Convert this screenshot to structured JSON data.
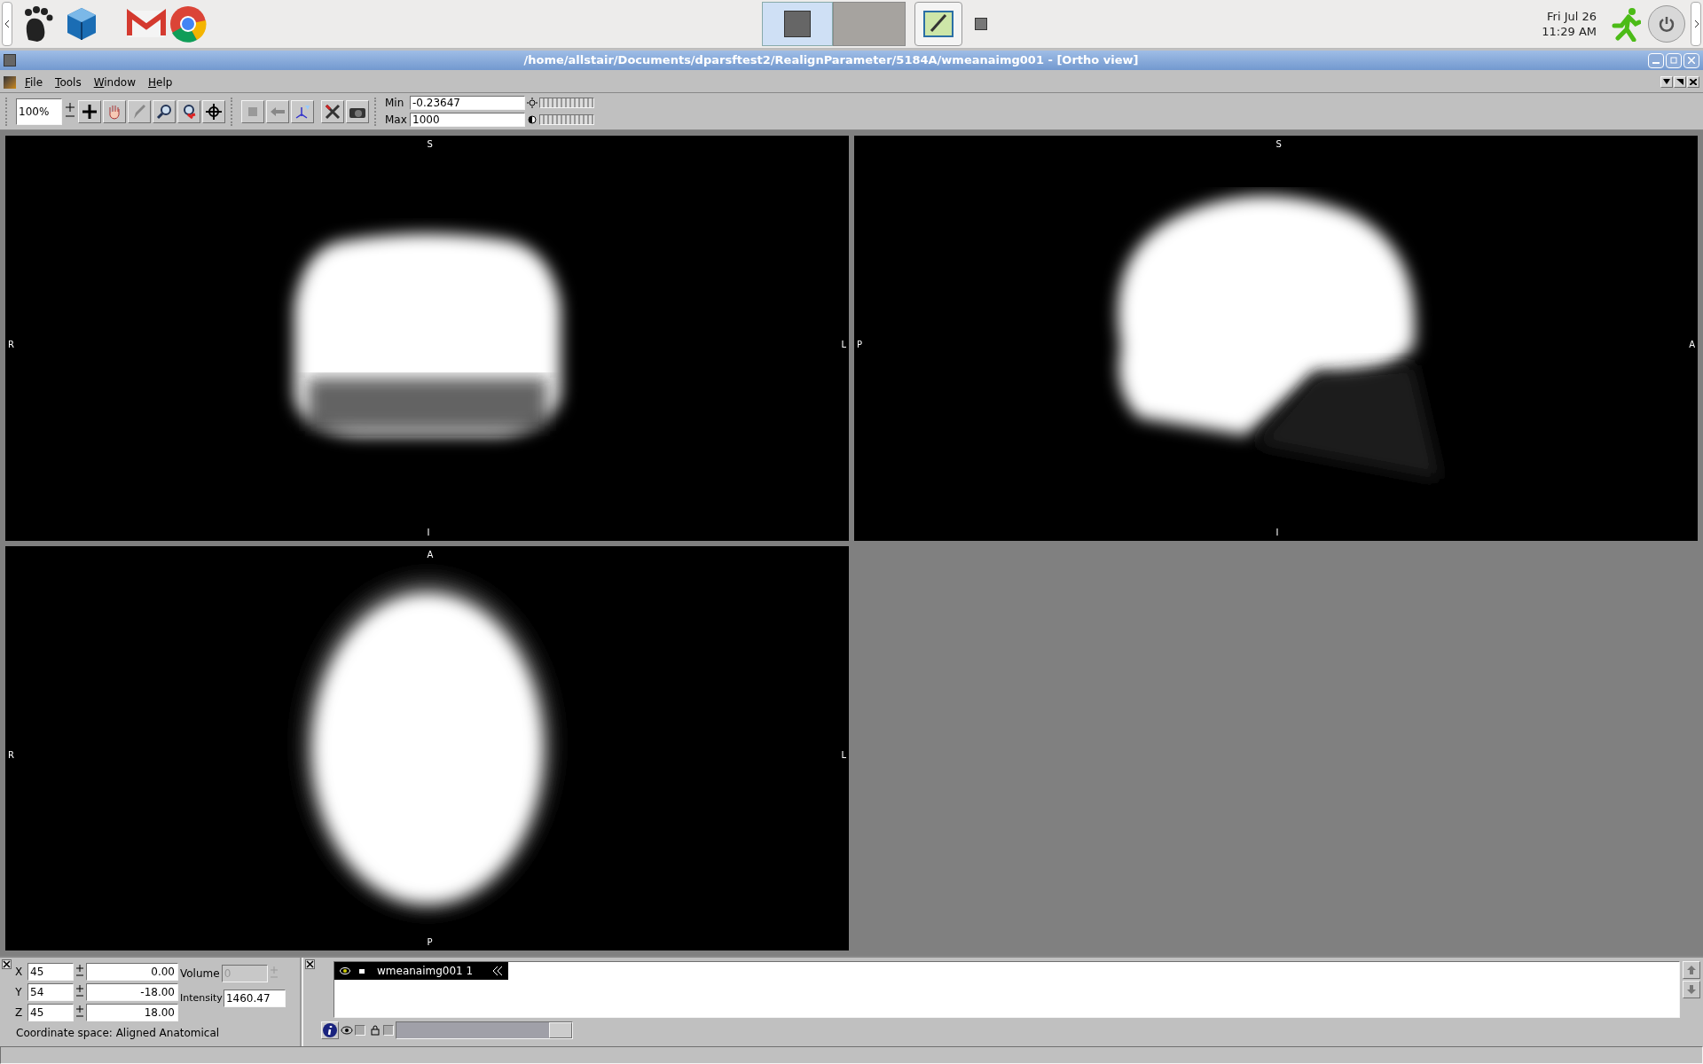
{
  "taskbar": {
    "date": "Fri Jul 26",
    "time": "11:29 AM"
  },
  "window": {
    "title": "/home/allstair/Documents/dparsftest2/RealignParameter/5184A/wmeanaimg001 - [Ortho view]"
  },
  "menu": [
    {
      "label": "File"
    },
    {
      "label": "Tools"
    },
    {
      "label": "Window"
    },
    {
      "label": "Help"
    }
  ],
  "toolbar": {
    "zoom": "100%",
    "min_label": "Min",
    "min": "-0.23647",
    "max_label": "Max",
    "max": "1000"
  },
  "views": [
    {
      "kind": "coronal",
      "top": "S",
      "bottom": "I",
      "left": "R",
      "right": "L"
    },
    {
      "kind": "sagittal",
      "top": "S",
      "bottom": "I",
      "left": "P",
      "right": "A"
    },
    {
      "kind": "axial",
      "top": "A",
      "bottom": "P",
      "left": "R",
      "right": "L"
    }
  ],
  "location": {
    "rows": [
      {
        "axis": "X",
        "voxel": "45",
        "world": "0.00"
      },
      {
        "axis": "Y",
        "voxel": "54",
        "world": "-18.00"
      },
      {
        "axis": "Z",
        "voxel": "45",
        "world": "18.00"
      }
    ],
    "volume_label": "Volume",
    "volume": "0",
    "volume_disabled": true,
    "intensity_label": "Intensity",
    "intensity": "1460.47",
    "coordinate_space": "Coordinate space: Aligned Anatomical"
  },
  "layers": {
    "items": [
      {
        "name": "wmeanaimg001 1",
        "selected": true
      }
    ],
    "visibility_checked": false,
    "lock_checked": false,
    "opacity": {
      "level": 1
    }
  }
}
